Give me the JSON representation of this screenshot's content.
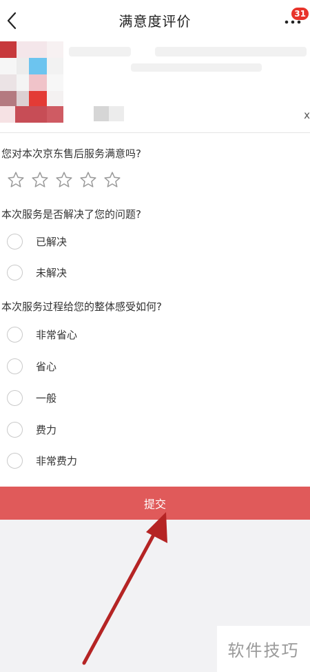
{
  "header": {
    "title": "满意度评价",
    "notification_count": "31",
    "back_icon": "chevron-left-icon",
    "more_icon": "more-dots-icon"
  },
  "product": {
    "close_label": "x"
  },
  "questions": [
    {
      "text": "您对本次京东售后服务满意吗?",
      "type": "rating",
      "max_stars": 5,
      "rating": 0
    },
    {
      "text": "本次服务是否解决了您的问题?",
      "type": "single-choice",
      "options": [
        "已解决",
        "未解决"
      ]
    },
    {
      "text": "本次服务过程给您的整体感受如何?",
      "type": "single-choice",
      "options": [
        "非常省心",
        "省心",
        "一般",
        "费力",
        "非常费力"
      ]
    }
  ],
  "submit_label": "提交",
  "watermark": "软件技巧",
  "colors": {
    "accent": "#e05a5a",
    "badge": "#e8332a",
    "arrow": "#b52424"
  }
}
